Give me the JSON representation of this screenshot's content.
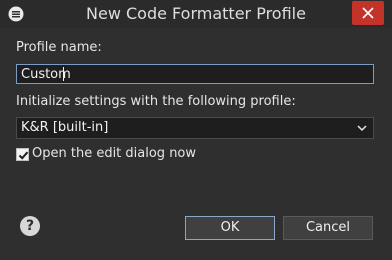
{
  "window": {
    "title": "New Code Formatter Profile"
  },
  "form": {
    "profile_name_label": "Profile name:",
    "profile_name_value": "Custom",
    "init_label": "Initialize settings with the following profile:",
    "init_selected": "K&R [built-in]",
    "open_dialog_label": "Open the edit dialog now",
    "open_dialog_checked": true
  },
  "buttons": {
    "ok": "OK",
    "cancel": "Cancel"
  },
  "icons": {
    "window_menu": "window-menu-icon",
    "close": "close-icon",
    "dropdown": "chevron-down-icon",
    "check": "check-icon",
    "help": "help-icon"
  },
  "colors": {
    "background": "#2f2f2f",
    "close_button": "#c4332a",
    "focus_border": "#7a9cc6"
  }
}
